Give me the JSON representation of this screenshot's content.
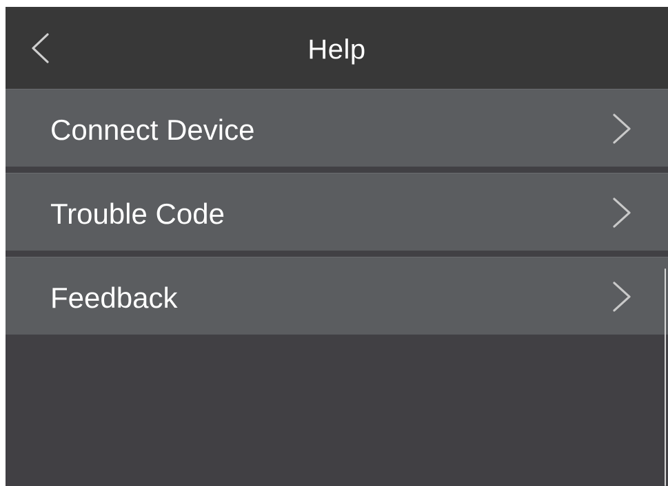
{
  "header": {
    "title": "Help",
    "back_icon": "chevron-left-icon"
  },
  "menu": {
    "items": [
      {
        "label": "Connect Device",
        "icon": "chevron-right-icon"
      },
      {
        "label": "Trouble Code",
        "icon": "chevron-right-icon"
      },
      {
        "label": "Feedback",
        "icon": "chevron-right-icon"
      }
    ]
  },
  "colors": {
    "header_bg": "#383838",
    "item_bg": "#5b5d60",
    "screen_bg": "#414044",
    "text": "#ffffff",
    "chevron": "#c9c9c9"
  }
}
